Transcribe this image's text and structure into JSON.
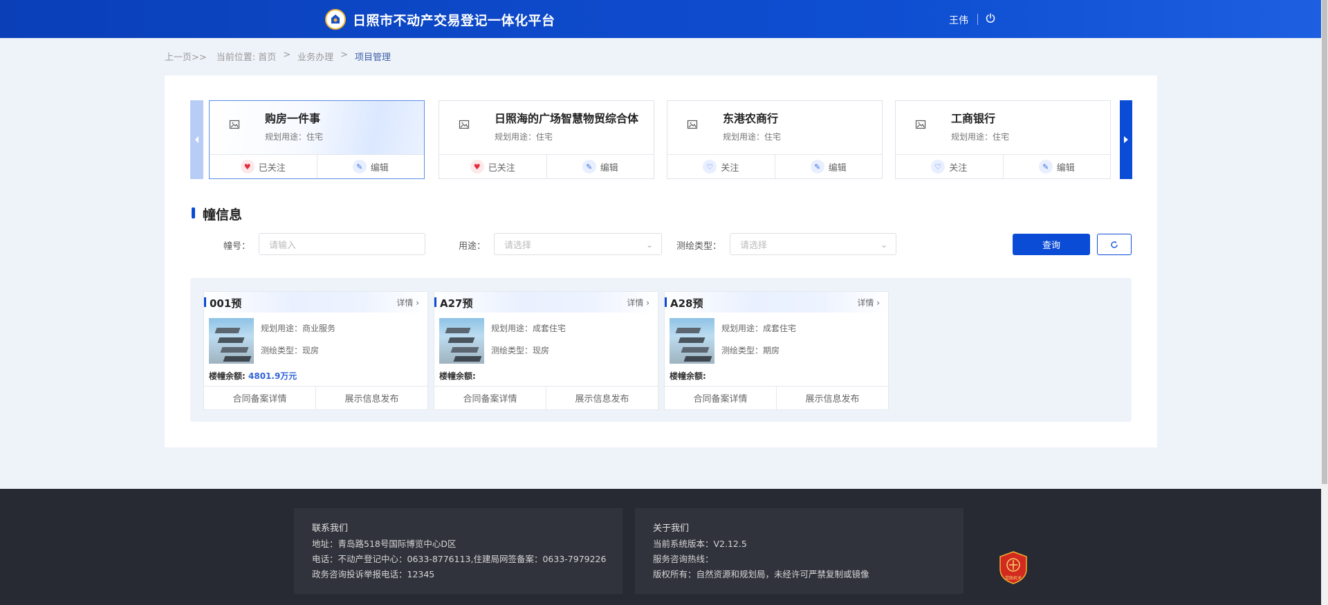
{
  "header": {
    "title": "日照市不动产交易登记一体化平台",
    "user": "王伟"
  },
  "breadcrumb": {
    "back": "上一页>>",
    "position": "当前位置:",
    "home": "首页",
    "sep1": ">",
    "business": "业务办理",
    "sep2": ">",
    "current": "项目管理"
  },
  "projects": [
    {
      "name": "购房一件事",
      "use": "规划用途：住宅",
      "follow": "已关注",
      "followed": true,
      "edit": "编辑"
    },
    {
      "name": "日照海的广场智慧物贸综合体",
      "use": "规划用途：住宅",
      "follow": "已关注",
      "followed": true,
      "edit": "编辑"
    },
    {
      "name": "东港农商行",
      "use": "规划用途：住宅",
      "follow": "关注",
      "followed": false,
      "edit": "编辑"
    },
    {
      "name": "工商银行",
      "use": "规划用途：住宅",
      "follow": "关注",
      "followed": false,
      "edit": "编辑"
    }
  ],
  "section": {
    "title": "幢信息"
  },
  "filters": {
    "building_no_label": "幢号：",
    "building_no_placeholder": "请输入",
    "usage_label": "用途：",
    "usage_placeholder": "请选择",
    "survey_label": "测绘类型：",
    "survey_placeholder": "请选择",
    "query": "查询"
  },
  "buildings": [
    {
      "name": "001预",
      "detail": "详情",
      "plan": "规划用途：商业服务",
      "mtype": "测绘类型：现房",
      "balance_label": "楼幢余额:",
      "balance_value": "4801.9万元",
      "contract": "合同备案详情",
      "publish": "展示信息发布"
    },
    {
      "name": "A27预",
      "detail": "详情",
      "plan": "规划用途：成套住宅",
      "mtype": "测绘类型：现房",
      "balance_label": "楼幢余额:",
      "balance_value": "",
      "contract": "合同备案详情",
      "publish": "展示信息发布"
    },
    {
      "name": "A28预",
      "detail": "详情",
      "plan": "规划用途：成套住宅",
      "mtype": "测绘类型：期房",
      "balance_label": "楼幢余额:",
      "balance_value": "",
      "contract": "合同备案详情",
      "publish": "展示信息发布"
    }
  ],
  "footer": {
    "contact": {
      "title": "联系我们",
      "address": "地址：青岛路518号国际博览中心D区",
      "phone": "电话：不动产登记中心：0633-8776113,住建局网签备案：0633-7979226",
      "complaint": "政务咨询投诉举报电话：12345"
    },
    "about": {
      "title": "关于我们",
      "version": "当前系统版本：V2.12.5",
      "hotline": "服务咨询热线：",
      "copyright": "版权所有：自然资源和规划局，未经许可严禁复制或镜像"
    },
    "badge_text": "党政机关"
  },
  "colors": {
    "primary": "#0a4cd5",
    "header": "#0d49c9",
    "footer": "#282a33",
    "heart": "#e62b3c"
  }
}
